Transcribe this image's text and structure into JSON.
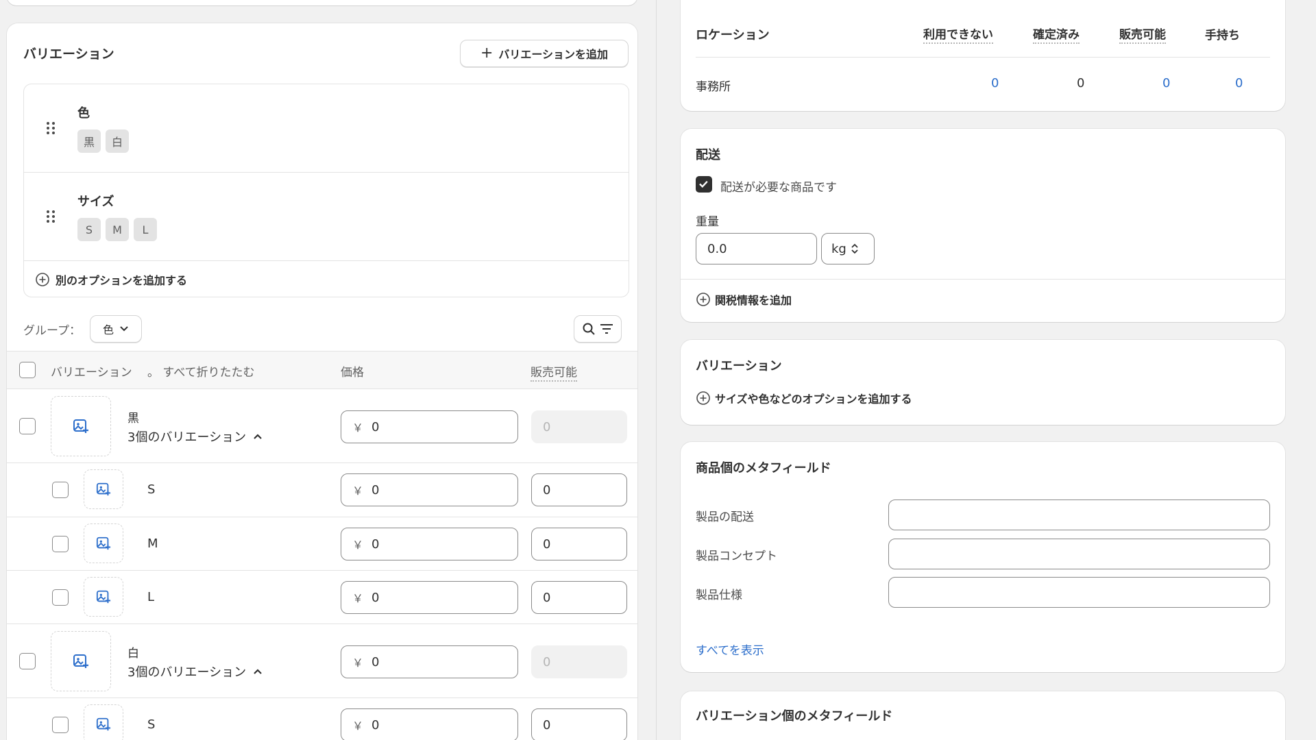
{
  "variations_card": {
    "title": "バリエーション",
    "add_variation_button": "バリエーションを追加",
    "options": [
      {
        "name": "色",
        "values": [
          "黒",
          "白"
        ]
      },
      {
        "name": "サイズ",
        "values": [
          "S",
          "M",
          "L"
        ]
      }
    ],
    "add_option_link": "別のオプションを追加する",
    "group_label": "グループ：",
    "group_value": "色",
    "table_header": {
      "variation": "バリエーション",
      "collapse_all": "。 すべて折りたたむ",
      "price": "価格",
      "available": "販売可能"
    },
    "groups": [
      {
        "name": "黒",
        "count_label": "3個のバリエーション",
        "price": "0",
        "available": "0",
        "children": [
          {
            "name": "S",
            "price": "0",
            "available": "0"
          },
          {
            "name": "M",
            "price": "0",
            "available": "0"
          },
          {
            "name": "L",
            "price": "0",
            "available": "0"
          }
        ]
      },
      {
        "name": "白",
        "count_label": "3個のバリエーション",
        "price": "0",
        "available": "0",
        "children": [
          {
            "name": "S",
            "price": "0",
            "available": "0"
          }
        ]
      }
    ],
    "currency_symbol": "￥"
  },
  "inventory_card": {
    "headers": {
      "location": "ロケーション",
      "unavailable": "利用できない",
      "committed": "確定済み",
      "available": "販売可能",
      "on_hand": "手持ち"
    },
    "row": {
      "location": "事務所",
      "unavailable": "0",
      "committed": "0",
      "available": "0",
      "on_hand": "0"
    }
  },
  "shipping_card": {
    "title": "配送",
    "physical_product_label": "配送が必要な商品です",
    "weight_label": "重量",
    "weight_value": "0.0",
    "weight_unit": "kg",
    "customs_link": "関税情報を追加"
  },
  "variants_card_right": {
    "title": "バリエーション",
    "add_options_link": "サイズや色などのオプションを追加する"
  },
  "product_metafields_card": {
    "title": "商品個のメタフィールド",
    "fields": [
      {
        "label": "製品の配送",
        "value": ""
      },
      {
        "label": "製品コンセプト",
        "value": ""
      },
      {
        "label": "製品仕様",
        "value": ""
      }
    ],
    "show_all_link": "すべてを表示"
  },
  "variant_metafields_card": {
    "title": "バリエーション個のメタフィールド"
  },
  "colors": {
    "accent_blue": "#2c6ecb",
    "text": "#303030",
    "muted": "#616161",
    "background": "#f1f1f1"
  }
}
